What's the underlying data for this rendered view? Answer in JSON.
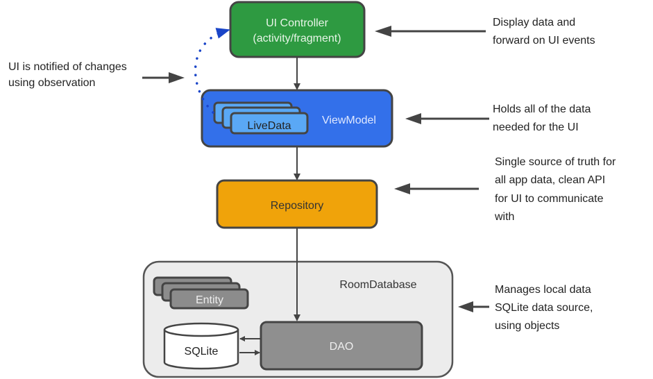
{
  "nodes": {
    "ui_controller": {
      "line1": "UI Controller",
      "line2": "(activity/fragment)",
      "color": "#2e9a41"
    },
    "viewmodel": {
      "label": "ViewModel",
      "color": "#3370ea"
    },
    "livedata": {
      "label": "LiveData",
      "color": "#5aa8f5"
    },
    "repository": {
      "label": "Repository",
      "color": "#f0a30a"
    },
    "room_database": {
      "label": "RoomDatabase",
      "color": "#ececec"
    },
    "entity": {
      "label": "Entity",
      "color": "#8c8c8c"
    },
    "sqlite": {
      "label": "SQLite"
    },
    "dao": {
      "label": "DAO",
      "color": "#8f8f8f"
    }
  },
  "annotations": {
    "observation": [
      "UI is notified of changes",
      "using observation"
    ],
    "ui_controller": [
      "Display data and",
      "forward on UI events"
    ],
    "viewmodel": [
      "Holds all of the data",
      "needed for the UI"
    ],
    "repository": [
      "Single source of truth for",
      "all app data, clean API",
      "for UI to communicate",
      "with"
    ],
    "room": [
      "Manages local data",
      "SQLite data source,",
      "using objects"
    ]
  },
  "observe_arrow_color": "#1a45c8"
}
